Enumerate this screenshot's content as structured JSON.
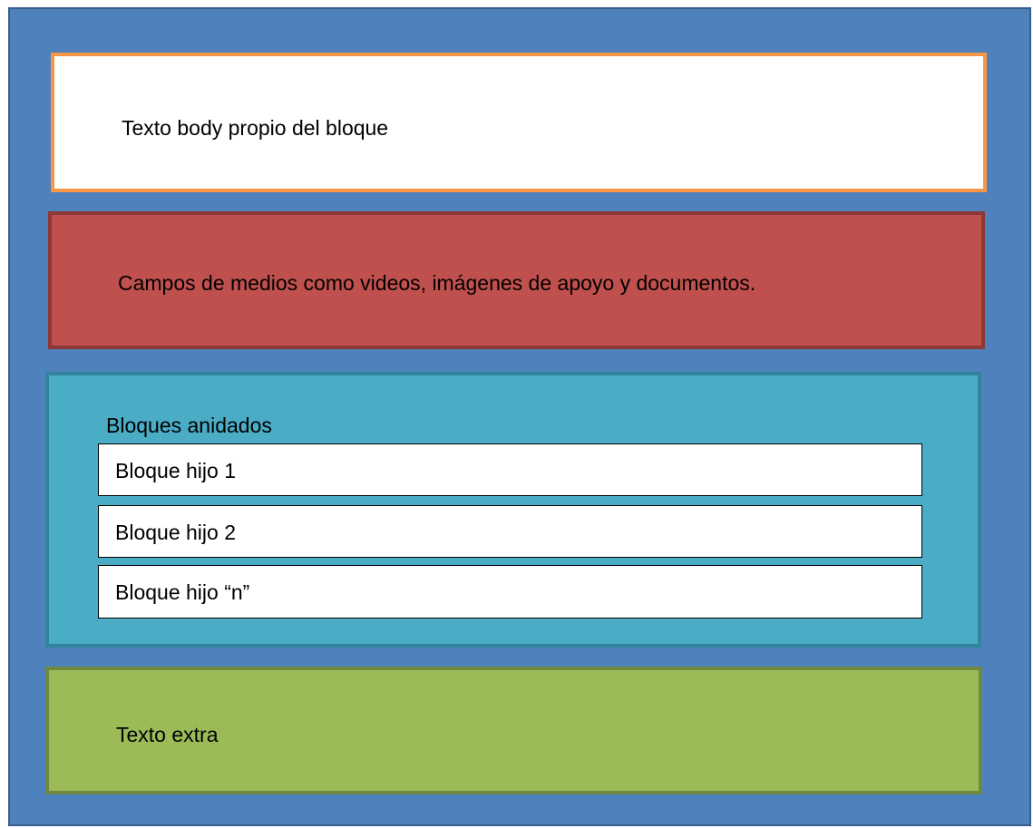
{
  "diagram": {
    "body_block": {
      "label": "Texto body propio del bloque",
      "fill": "#ffffff",
      "border": "#f79646"
    },
    "media_block": {
      "label": "Campos de medios como videos, imágenes de apoyo y documentos.",
      "fill": "#c0504d",
      "border": "#8c3836"
    },
    "nested_block": {
      "title": "Bloques anidados",
      "fill": "#4bacc6",
      "border": "#31849b",
      "children": [
        {
          "label": "Bloque hijo 1"
        },
        {
          "label": "Bloque hijo 2"
        },
        {
          "label": "Bloque hijo “n”"
        }
      ]
    },
    "extra_block": {
      "label": "Texto extra",
      "fill": "#9bbb59",
      "border": "#71893f"
    },
    "container": {
      "fill": "#4f81bd",
      "border": "#385d8a"
    }
  }
}
